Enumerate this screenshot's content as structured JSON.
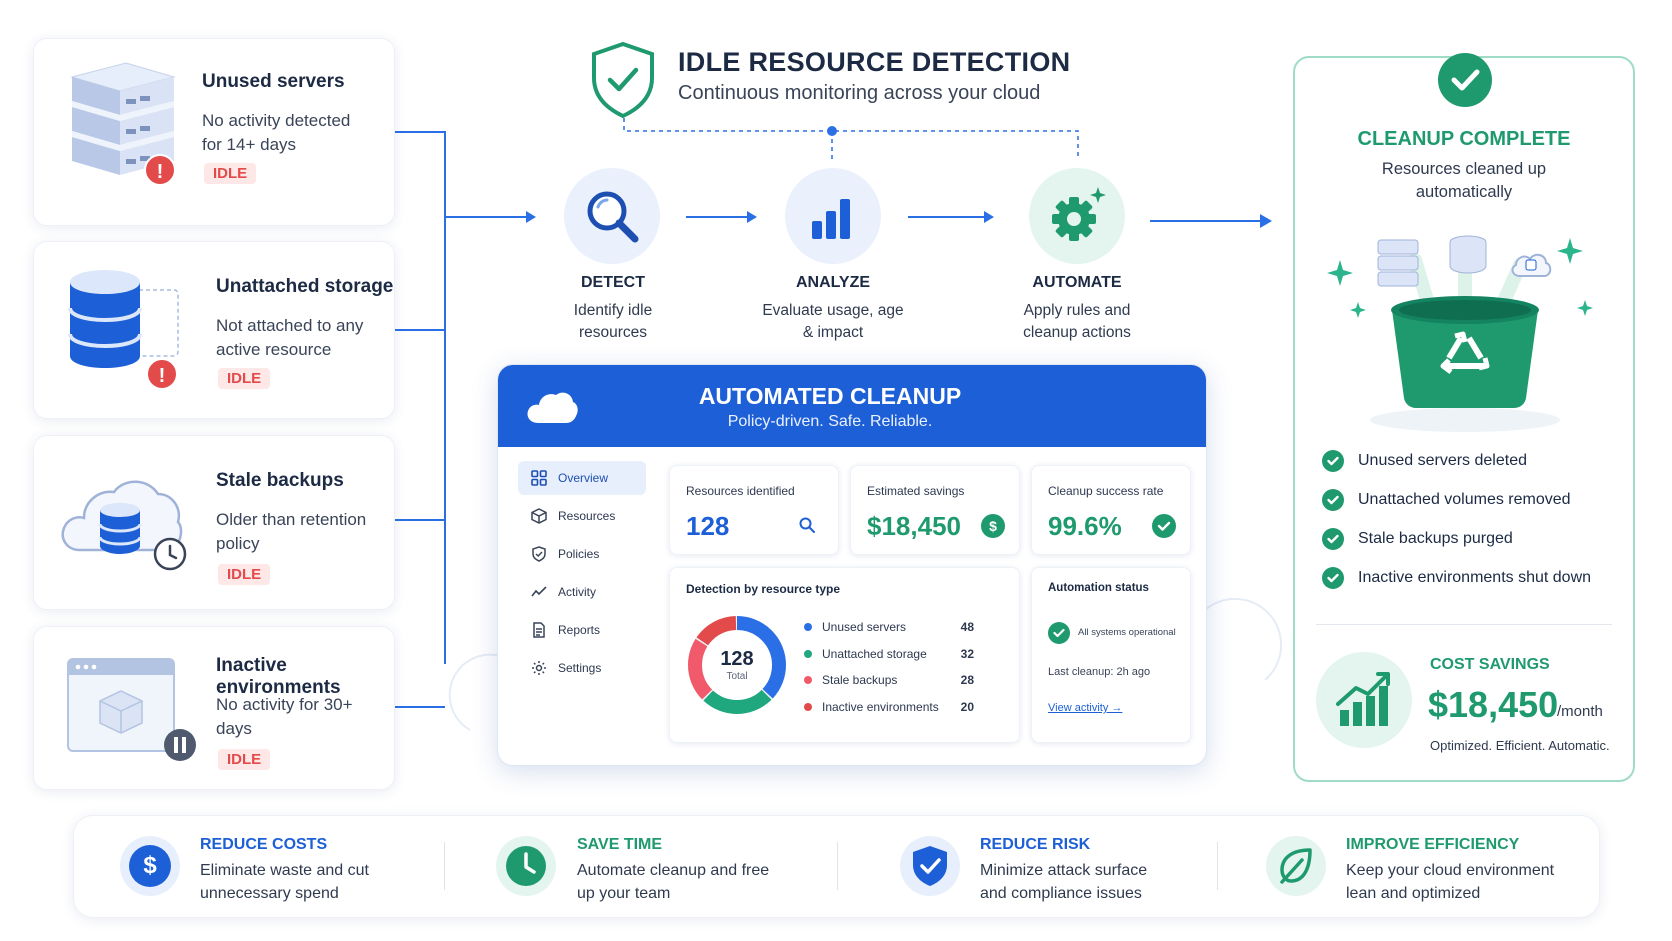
{
  "header": {
    "title": "IDLE RESOURCE DETECTION",
    "subtitle": "Continuous monitoring across your cloud"
  },
  "resources": [
    {
      "title": "Unused servers",
      "desc": "No activity detected for 14+ days",
      "badge": "IDLE",
      "icon": "server-stack-icon"
    },
    {
      "title": "Unattached storage",
      "desc": "Not attached to any active resource",
      "badge": "IDLE",
      "icon": "database-icon"
    },
    {
      "title": "Stale backups",
      "desc": "Older than retention policy",
      "badge": "IDLE",
      "icon": "cloud-backup-icon"
    },
    {
      "title": "Inactive environments",
      "desc": "No activity for 30+ days",
      "badge": "IDLE",
      "icon": "browser-window-icon"
    }
  ],
  "steps": [
    {
      "title": "DETECT",
      "desc": "Identify idle resources",
      "icon": "magnifier-icon"
    },
    {
      "title": "ANALYZE",
      "desc": "Evaluate usage, age & impact",
      "icon": "bar-chart-icon"
    },
    {
      "title": "AUTOMATE",
      "desc": "Apply rules and cleanup actions",
      "icon": "gear-icon"
    }
  ],
  "dashboard": {
    "title": "AUTOMATED CLEANUP",
    "subtitle": "Policy-driven. Safe. Reliable.",
    "nav": [
      "Overview",
      "Resources",
      "Policies",
      "Activity",
      "Reports",
      "Settings"
    ],
    "active_nav": "Overview",
    "stats": [
      {
        "label": "Resources identified",
        "value": "128"
      },
      {
        "label": "Estimated savings",
        "value": "$18,450"
      },
      {
        "label": "Cleanup success rate",
        "value": "99.6%"
      }
    ],
    "detection": {
      "title": "Detection by resource type",
      "total": "128",
      "total_label": "Total"
    },
    "automation": {
      "title": "Automation status",
      "status": "All systems operational",
      "last_cleanup": "Last cleanup: 2h ago",
      "link": "View activity →"
    }
  },
  "chart_data": {
    "type": "pie",
    "title": "Detection by resource type",
    "categories": [
      "Unused servers",
      "Unattached storage",
      "Stale backups",
      "Inactive environments"
    ],
    "values": [
      48,
      32,
      28,
      20
    ],
    "colors": [
      "#2b6fe6",
      "#1fa77e",
      "#f05a6a",
      "#e34a4a"
    ]
  },
  "complete": {
    "title": "CLEANUP COMPLETE",
    "subtitle": "Resources cleaned up automatically",
    "items": [
      "Unused servers deleted",
      "Unattached volumes removed",
      "Stale backups purged",
      "Inactive environments shut down"
    ],
    "savings_label": "COST SAVINGS",
    "savings_value": "$18,450",
    "savings_unit": "/month",
    "tagline": "Optimized. Efficient. Automatic."
  },
  "benefits": [
    {
      "title": "REDUCE COSTS",
      "desc": "Eliminate waste and cut unnecessary spend",
      "icon": "dollar-icon",
      "color": "#1d5fd6"
    },
    {
      "title": "SAVE TIME",
      "desc": "Automate cleanup and free up your team",
      "icon": "clock-icon",
      "color": "#1f9a6e"
    },
    {
      "title": "REDUCE RISK",
      "desc": "Minimize attack surface and compliance issues",
      "icon": "shield-check-icon",
      "color": "#1d5fd6"
    },
    {
      "title": "IMPROVE EFFICIENCY",
      "desc": "Keep your cloud environment lean and optimized",
      "icon": "leaf-icon",
      "color": "#1f9a6e"
    }
  ],
  "colors": {
    "primary_blue": "#1d5fd6",
    "green": "#1f9a6e",
    "idle_red": "#e34a4a",
    "navy": "#1c2a44"
  }
}
